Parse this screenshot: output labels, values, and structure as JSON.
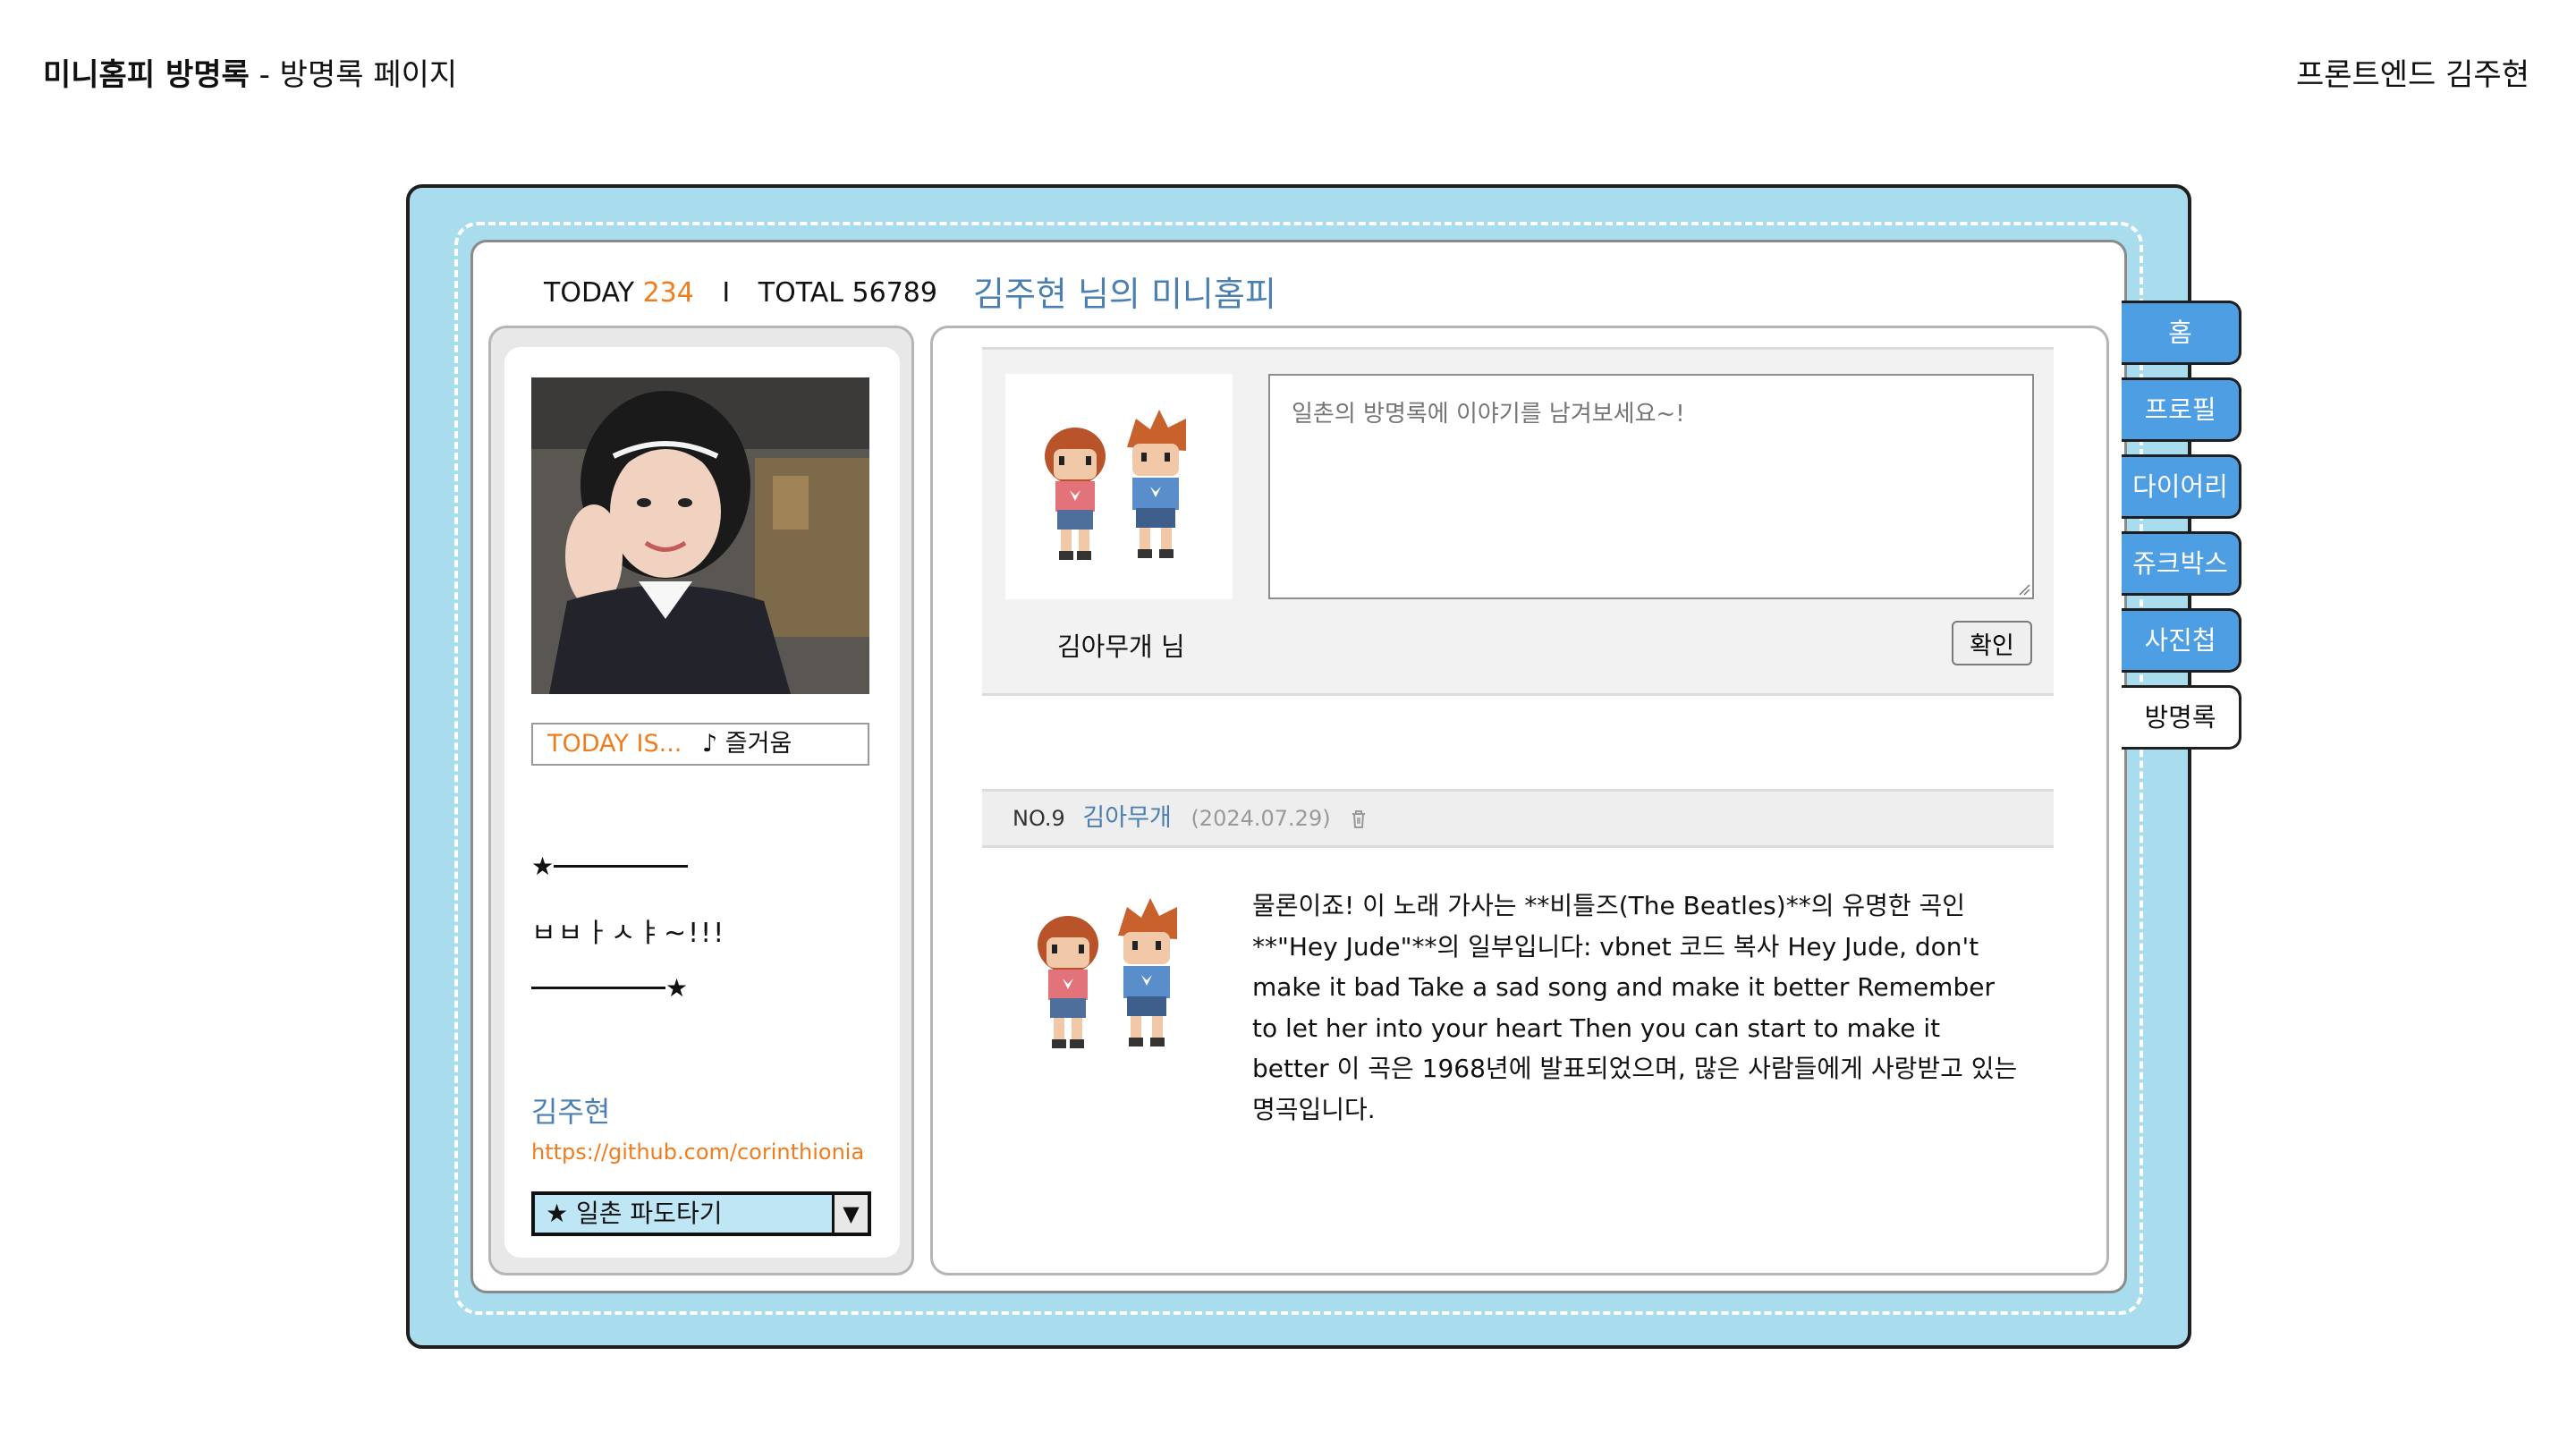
{
  "header": {
    "title_bold": "미니홈피 방명록",
    "title_rest": "- 방명록 페이지",
    "author": "프론트엔드 김주현"
  },
  "visitor": {
    "today_label": "TODAY",
    "today_count": "234",
    "separator": "I",
    "total_label": "TOTAL",
    "total_count": "56789"
  },
  "minihompy_title": "김주현 님의 미니홈피",
  "profile": {
    "today_is_label": "TODAY IS...",
    "mood": "♪ 즐거움",
    "star": "★",
    "status": "ㅂㅂㅏㅅㅑ~!!!",
    "name": "김주현",
    "link": "https://github.com/corinthionia",
    "pado_label": "★ 일촌 파도타기",
    "pado_arrow": "▼"
  },
  "guestbook": {
    "writer_name": "김아무개 님",
    "placeholder": "일촌의 방명록에 이야기를 남겨보세요~!",
    "confirm_label": "확인",
    "posts": [
      {
        "no": "NO.9",
        "author": "김아무개",
        "date": "(2024.07.29)",
        "body": "물론이죠! 이 노래 가사는 **비틀즈(The Beatles)**의 유명한 곡인 **\"Hey Jude\"**의 일부입니다: vbnet 코드 복사 Hey Jude, don't make it bad Take a sad song and make it better Remember to let her into your heart Then you can start to make it better 이 곡은 1968년에 발표되었으며, 많은 사람들에게 사랑받고 있는 명곡입니다."
      }
    ]
  },
  "tabs": [
    {
      "label": "홈",
      "active": false
    },
    {
      "label": "프로필",
      "active": false
    },
    {
      "label": "다이어리",
      "active": false
    },
    {
      "label": "쥬크박스",
      "active": false
    },
    {
      "label": "사진첩",
      "active": false
    },
    {
      "label": "방명록",
      "active": true
    }
  ],
  "colors": {
    "frame_bg": "#a9dded",
    "accent_blue": "#4a7fb0",
    "accent_orange": "#f07c1e",
    "tab_blue": "#4e9ee3"
  }
}
